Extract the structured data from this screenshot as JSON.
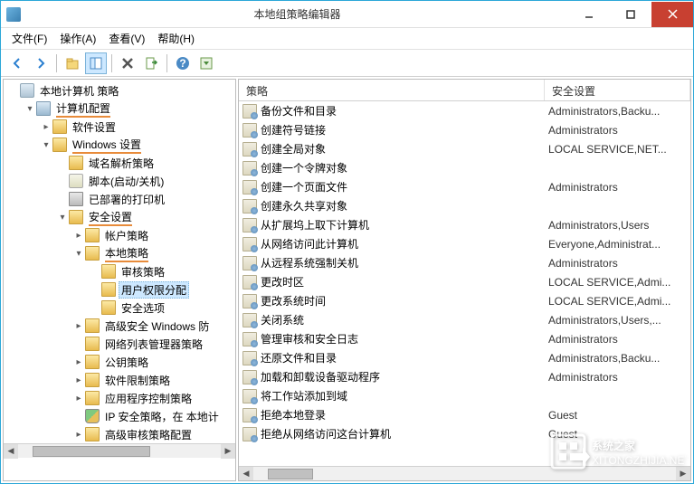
{
  "window": {
    "title": "本地组策略编辑器"
  },
  "menu": {
    "file": "文件(F)",
    "action": "操作(A)",
    "view": "查看(V)",
    "help": "帮助(H)"
  },
  "tree": {
    "root": "本地计算机 策略",
    "computer_config": "计算机配置",
    "software_settings": "软件设置",
    "windows_settings": "Windows 设置",
    "dns_policy": "域名解析策略",
    "scripts": "脚本(启动/关机)",
    "printers": "已部署的打印机",
    "security_settings": "安全设置",
    "account_policy": "帐户策略",
    "local_policy": "本地策略",
    "audit_policy": "审核策略",
    "user_rights": "用户权限分配",
    "security_options": "安全选项",
    "advanced_firewall": "高级安全 Windows 防",
    "network_list": "网络列表管理器策略",
    "public_key": "公钥策略",
    "software_restrict": "软件限制策略",
    "app_control": "应用程序控制策略",
    "ip_security": "IP 安全策略，在 本地计",
    "advanced_audit": "高级审核策略配置"
  },
  "list": {
    "header_policy": "策略",
    "header_security": "安全设置",
    "rows": [
      {
        "name": "备份文件和目录",
        "sec": "Administrators,Backu..."
      },
      {
        "name": "创建符号链接",
        "sec": "Administrators"
      },
      {
        "name": "创建全局对象",
        "sec": "LOCAL SERVICE,NET..."
      },
      {
        "name": "创建一个令牌对象",
        "sec": ""
      },
      {
        "name": "创建一个页面文件",
        "sec": "Administrators"
      },
      {
        "name": "创建永久共享对象",
        "sec": ""
      },
      {
        "name": "从扩展坞上取下计算机",
        "sec": "Administrators,Users"
      },
      {
        "name": "从网络访问此计算机",
        "sec": "Everyone,Administrat..."
      },
      {
        "name": "从远程系统强制关机",
        "sec": "Administrators"
      },
      {
        "name": "更改时区",
        "sec": "LOCAL SERVICE,Admi..."
      },
      {
        "name": "更改系统时间",
        "sec": "LOCAL SERVICE,Admi..."
      },
      {
        "name": "关闭系统",
        "sec": "Administrators,Users,..."
      },
      {
        "name": "管理审核和安全日志",
        "sec": "Administrators"
      },
      {
        "name": "还原文件和目录",
        "sec": "Administrators,Backu..."
      },
      {
        "name": "加载和卸载设备驱动程序",
        "sec": "Administrators"
      },
      {
        "name": "将工作站添加到域",
        "sec": ""
      },
      {
        "name": "拒绝本地登录",
        "sec": "Guest"
      },
      {
        "name": "拒绝从网络访问这台计算机",
        "sec": "Guest"
      }
    ]
  },
  "watermark": {
    "line1": "系统之家",
    "line2": "XITONGZHIJIA.NET"
  }
}
